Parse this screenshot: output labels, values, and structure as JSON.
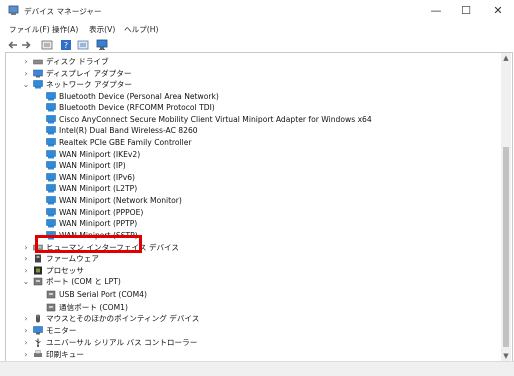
{
  "window": {
    "title": "デバイス マネージャー",
    "minimize": "—",
    "maximize": "☐",
    "close": "✕"
  },
  "menu": [
    "ファイル(F)",
    "操作(A)",
    "表示(V)",
    "ヘルプ(H)"
  ],
  "toolbar": [
    "back-icon",
    "forward-icon",
    "properties-icon",
    "help-icon",
    "show-hidden-icon",
    "monitor-icon"
  ],
  "tree": {
    "disk_drives": "ディスク ドライブ",
    "display_adapters": "ディスプレイ アダプター",
    "network_adapters": "ネットワーク アダプター",
    "network_items": [
      "Bluetooth Device (Personal Area Network)",
      "Bluetooth Device (RFCOMM Protocol TDI)",
      "Cisco AnyConnect Secure Mobility Client Virtual Miniport Adapter for Windows x64",
      "Intel(R) Dual Band Wireless-AC 8260",
      "Realtek PCIe GBE Family Controller",
      "WAN Miniport (IKEv2)",
      "WAN Miniport (IP)",
      "WAN Miniport (IPv6)",
      "WAN Miniport (L2TP)",
      "WAN Miniport (Network Monitor)",
      "WAN Miniport (PPPOE)",
      "WAN Miniport (PPTP)",
      "WAN Miniport (SSTP)"
    ],
    "hid": "ヒューマン インターフェイス デバイス",
    "firmware": "ファームウェア",
    "processors": "プロセッサ",
    "ports": "ポート (COM と LPT)",
    "port_items": [
      "USB Serial Port (COM4)",
      "通信ポート (COM1)"
    ],
    "mice": "マウスとそのほかのポインティング デバイス",
    "monitors": "モニター",
    "usb": "ユニバーサル シリアル バス コントローラー",
    "print_queues": "印刷キュー"
  },
  "colors": {
    "highlight": "#e00000",
    "accent": "#1e7fd6"
  }
}
